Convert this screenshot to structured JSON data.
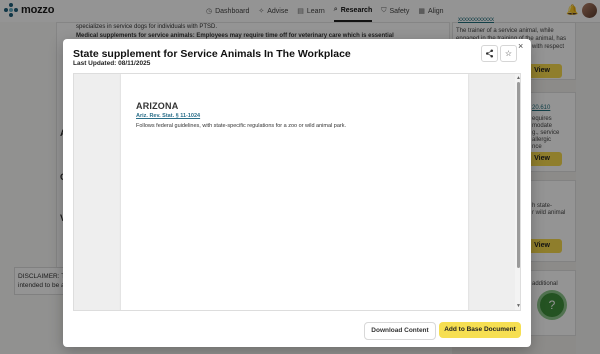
{
  "app": {
    "logo_text": "mozzo",
    "nav": [
      {
        "icon": "◷",
        "label": "Dashboard"
      },
      {
        "icon": "✧",
        "label": "Advise"
      },
      {
        "icon": "▤",
        "label": "Learn"
      },
      {
        "icon": "⌕",
        "label": "Research"
      },
      {
        "icon": "⛉",
        "label": "Safety"
      },
      {
        "icon": "▦",
        "label": "Align"
      }
    ]
  },
  "background": {
    "line1": "specializes in service dogs for individuals with PTSD.",
    "line2": "Medical supplements for service animals: Employees may require time off for veterinary care which is essential",
    "letters": [
      "A",
      "C",
      "V"
    ],
    "disclaimer_line1": "DISCLAIMER: Th",
    "disclaimer_line2": "intended to be a",
    "side": {
      "top_link": "xxxxxxxxxxxx",
      "card1_lines": [
        "The trainer of a service animal, while",
        "engaged in the training of the animal, has",
        "with respect"
      ],
      "card1_button": "View",
      "card2_link": "20.610",
      "card2_lines": [
        "equires",
        "modate",
        "g., service",
        "allergic",
        "nce"
      ],
      "card2_button": "View",
      "card3_lines": [
        "h state-",
        "r wild animal"
      ],
      "card3_button": "View",
      "card4_line": "additional"
    }
  },
  "modal": {
    "title": "State supplement for Service Animals In The Workplace",
    "updated": "Last Updated: 08/11/2025",
    "close_glyph": "×",
    "share_glyph": "⋰",
    "star_glyph": "☆",
    "document": {
      "state": "ARIZONA",
      "statute": "Ariz. Rev. Stat. § 11-1024",
      "description": "Follows federal guidelines, with state-specific regulations for a zoo or wild animal park."
    },
    "download_label": "Download Content",
    "add_label": "Add to Base Document"
  }
}
